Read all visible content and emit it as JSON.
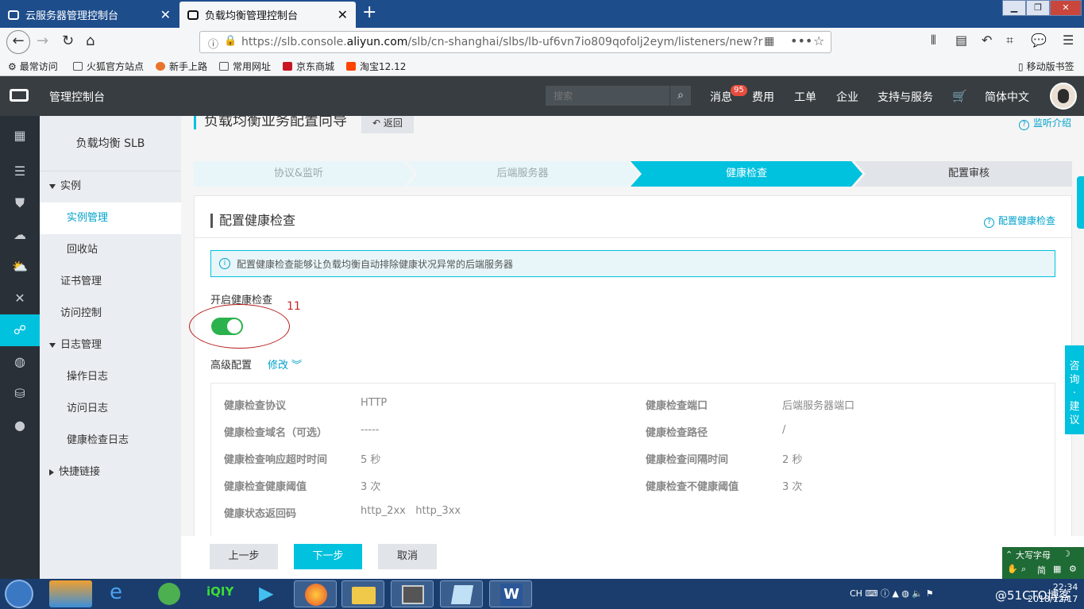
{
  "browser": {
    "tabs": [
      {
        "title": "云服务器管理控制台",
        "active": false
      },
      {
        "title": "负载均衡管理控制台",
        "active": true
      }
    ],
    "new_tab": "+",
    "url_prefix": "https://slb.console.",
    "url_domain": "aliyun.com",
    "url_path": "/slb/cn-shanghai/slbs/lb-uf6vn7io809qofolj2eym/listeners/new?r",
    "bookmarks": [
      "最常访问",
      "火狐官方站点",
      "新手上路",
      "常用网址",
      "京东商城",
      "淘宝12.12"
    ],
    "mobile_bookmarks": "移动版书签"
  },
  "topnav": {
    "title": "管理控制台",
    "search_placeholder": "搜索",
    "messages_label": "消息",
    "messages_count": "95",
    "items": [
      "费用",
      "工单",
      "企业",
      "支持与服务",
      "简体中文"
    ]
  },
  "sidebar": {
    "title": "负载均衡 SLB",
    "items": [
      {
        "label": "实例",
        "type": "group-open"
      },
      {
        "label": "实例管理",
        "type": "sub",
        "active": true
      },
      {
        "label": "回收站",
        "type": "sub"
      },
      {
        "label": "证书管理",
        "type": "top"
      },
      {
        "label": "访问控制",
        "type": "top"
      },
      {
        "label": "日志管理",
        "type": "group-open"
      },
      {
        "label": "操作日志",
        "type": "sub"
      },
      {
        "label": "访问日志",
        "type": "sub"
      },
      {
        "label": "健康检查日志",
        "type": "sub"
      },
      {
        "label": "快捷链接",
        "type": "group-closed"
      }
    ]
  },
  "page": {
    "title": "负载均衡业务配置向导",
    "back_label": "返回",
    "help_link": "监听介绍",
    "steps": [
      {
        "label": "协议&监听",
        "state": "done"
      },
      {
        "label": "后端服务器",
        "state": "done"
      },
      {
        "label": "健康检查",
        "state": "active"
      },
      {
        "label": "配置审核",
        "state": "todo"
      }
    ],
    "panel": {
      "title": "配置健康检查",
      "help_link": "配置健康检查",
      "info_text": "配置健康检查能够让负载均衡自动排除健康状况异常的后端服务器",
      "enable_label": "开启健康检查",
      "enable_on": true,
      "annotation_number": "11",
      "advanced_label": "高级配置",
      "edit_label": "修改",
      "config": [
        {
          "key": "健康检查协议",
          "value": "HTTP"
        },
        {
          "key": "健康检查端口",
          "value": "后端服务器端口"
        },
        {
          "key": "健康检查域名（可选）",
          "value": "-----"
        },
        {
          "key": "健康检查路径",
          "value": "/"
        },
        {
          "key": "健康检查响应超时时间",
          "value": "5 秒"
        },
        {
          "key": "健康检查间隔时间",
          "value": "2 秒"
        },
        {
          "key": "健康检查健康阈值",
          "value": "3 次"
        },
        {
          "key": "健康检查不健康阈值",
          "value": "3 次"
        },
        {
          "key": "健康状态返回码",
          "value": "http_2xx   http_3xx"
        }
      ]
    }
  },
  "footer": {
    "prev_label": "上一步",
    "next_label": "下一步",
    "cancel_label": "取消"
  },
  "advice_widget": {
    "chars": [
      "咨",
      "询",
      "·",
      "建",
      "议"
    ]
  },
  "ime": {
    "line1": "大写字母",
    "line2": "简"
  },
  "taskbar": {
    "tray_lang": "CH",
    "time": "22:34",
    "date": "2018/12/17"
  },
  "watermark": "@51CTO博客",
  "colors": {
    "accent": "#00c1de",
    "link": "#00a2ca",
    "toggle_on": "#2bb24c",
    "topnav_bg": "#373d41",
    "rail_bg": "#293038",
    "annotation": "#c62828"
  }
}
